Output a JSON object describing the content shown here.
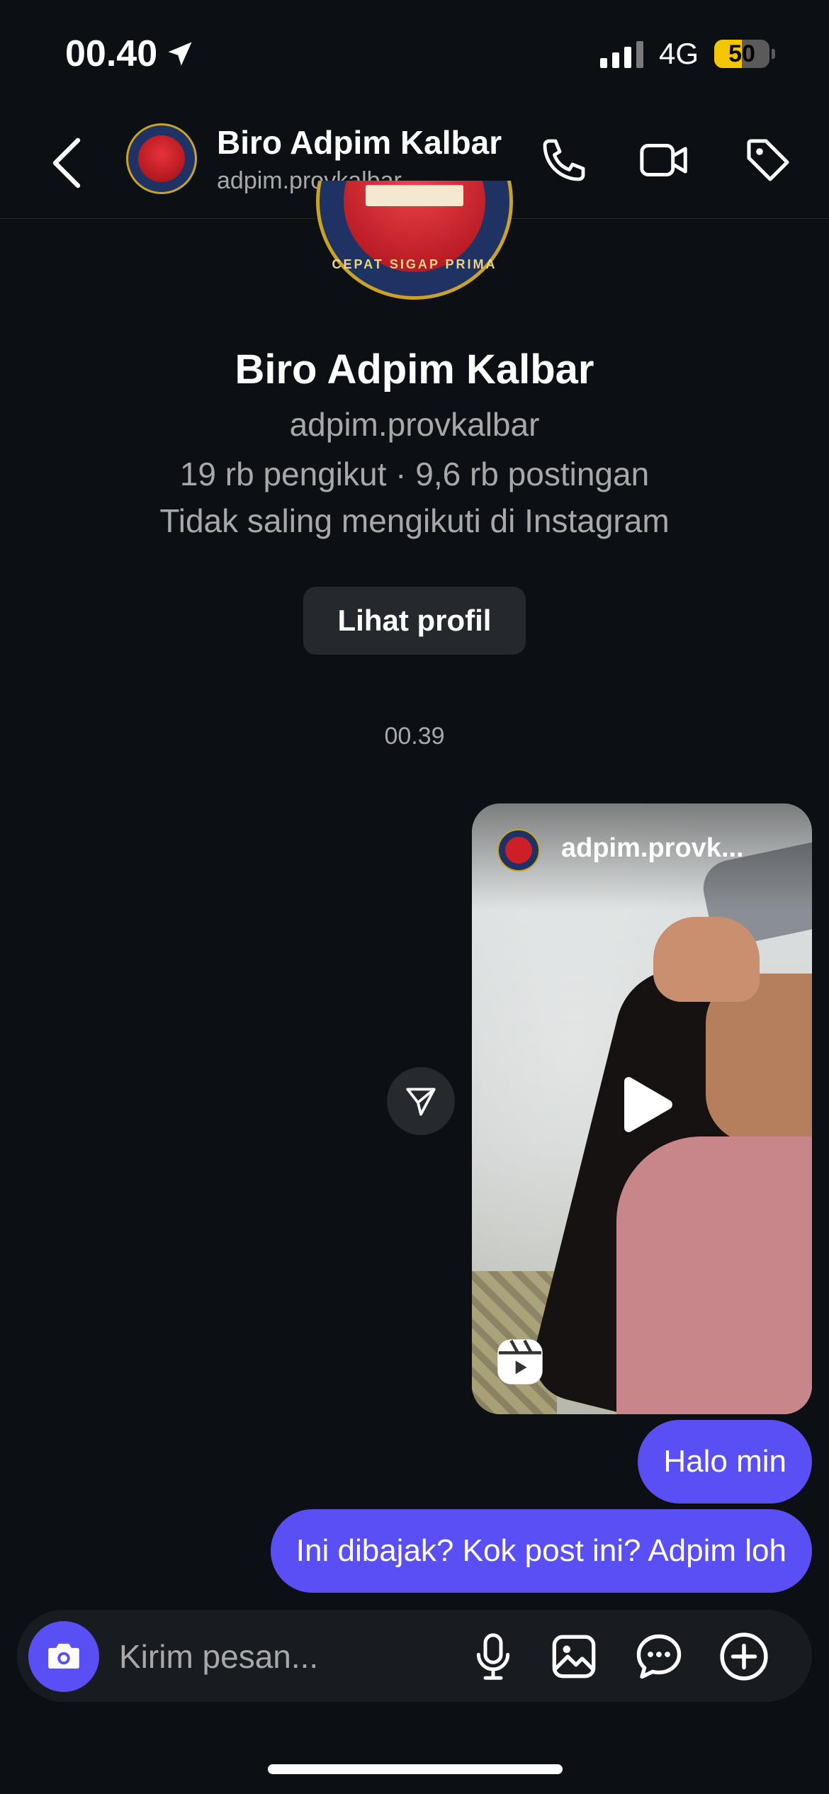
{
  "status_bar": {
    "time": "00.40",
    "network": "4G",
    "battery": "50",
    "battery_level": 0.5,
    "battery_color": "#f3c600"
  },
  "header": {
    "name": "Biro Adpim Kalbar",
    "username": "adpim.provkalbar",
    "icons": [
      "back-arrow-icon",
      "phone-icon",
      "video-camera-icon",
      "tag-icon"
    ]
  },
  "profile": {
    "logo_motto": "CEPAT SIGAP PRIMA",
    "name": "Biro Adpim Kalbar",
    "username": "adpim.provkalbar",
    "stats": "19 rb pengikut · 9,6 rb postingan",
    "follow_status": "Tidak saling mengikuti di Instagram",
    "view_profile_label": "Lihat profil"
  },
  "chat": {
    "timestamp": "00.39",
    "shared_post": {
      "username": "adpim.provk...",
      "type": "reel"
    },
    "messages": [
      {
        "text": "Halo min",
        "sender": "me"
      },
      {
        "text": "Ini dibajak? Kok post ini? Adpim loh",
        "sender": "me"
      }
    ],
    "bubble_color": "#5a4ff5"
  },
  "composer": {
    "placeholder": "Kirim pesan...",
    "icons": [
      "camera-icon",
      "microphone-icon",
      "gallery-icon",
      "sticker-chat-icon",
      "plus-circle-icon"
    ]
  }
}
